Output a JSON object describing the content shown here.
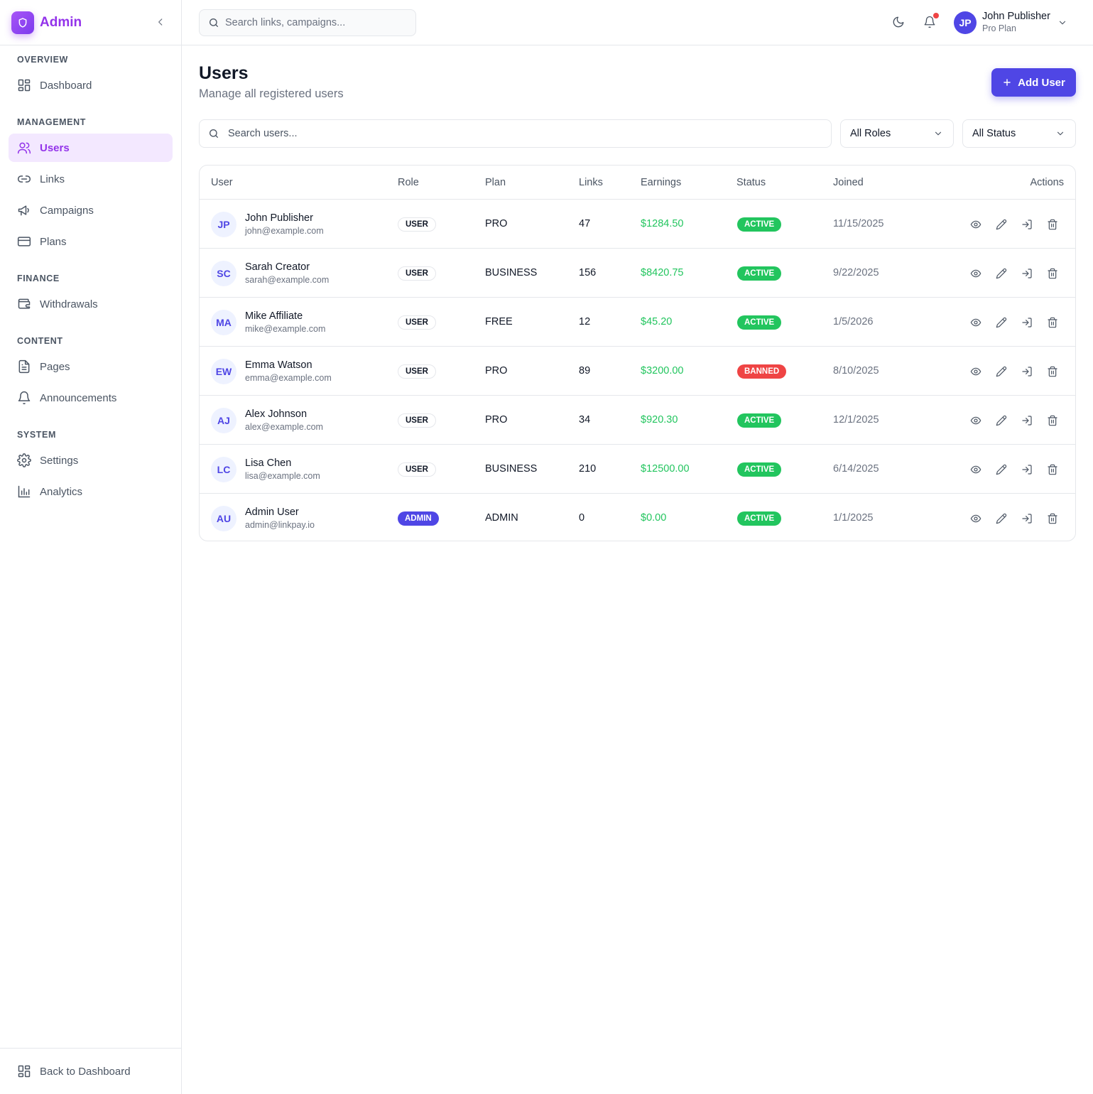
{
  "sidebar": {
    "brand": "Admin",
    "sections": [
      {
        "label": "OVERVIEW",
        "items": [
          {
            "label": "Dashboard",
            "icon": "dashboard-icon"
          }
        ]
      },
      {
        "label": "MANAGEMENT",
        "items": [
          {
            "label": "Users",
            "icon": "users-icon",
            "active": true
          },
          {
            "label": "Links",
            "icon": "link-icon"
          },
          {
            "label": "Campaigns",
            "icon": "megaphone-icon"
          },
          {
            "label": "Plans",
            "icon": "credit-card-icon"
          }
        ]
      },
      {
        "label": "FINANCE",
        "items": [
          {
            "label": "Withdrawals",
            "icon": "wallet-icon"
          }
        ]
      },
      {
        "label": "CONTENT",
        "items": [
          {
            "label": "Pages",
            "icon": "file-text-icon"
          },
          {
            "label": "Announcements",
            "icon": "bell-icon"
          }
        ]
      },
      {
        "label": "SYSTEM",
        "items": [
          {
            "label": "Settings",
            "icon": "gear-icon"
          },
          {
            "label": "Analytics",
            "icon": "bar-chart-icon"
          }
        ]
      }
    ],
    "footer": {
      "label": "Back to Dashboard",
      "icon": "dashboard-icon"
    }
  },
  "topbar": {
    "search_placeholder": "Search links, campaigns...",
    "user": {
      "initials": "JP",
      "name": "John Publisher",
      "plan": "Pro Plan"
    }
  },
  "page": {
    "title": "Users",
    "subtitle": "Manage all registered users",
    "add_button": "Add User",
    "search_placeholder": "Search users...",
    "role_filter": "All Roles",
    "status_filter": "All Status"
  },
  "table": {
    "headers": [
      "User",
      "Role",
      "Plan",
      "Links",
      "Earnings",
      "Status",
      "Joined",
      "Actions"
    ],
    "rows": [
      {
        "initials": "JP",
        "name": "John Publisher",
        "email": "john@example.com",
        "role": "USER",
        "plan": "PRO",
        "links": "47",
        "earnings": "$1284.50",
        "status": "ACTIVE",
        "joined": "11/15/2025"
      },
      {
        "initials": "SC",
        "name": "Sarah Creator",
        "email": "sarah@example.com",
        "role": "USER",
        "plan": "BUSINESS",
        "links": "156",
        "earnings": "$8420.75",
        "status": "ACTIVE",
        "joined": "9/22/2025"
      },
      {
        "initials": "MA",
        "name": "Mike Affiliate",
        "email": "mike@example.com",
        "role": "USER",
        "plan": "FREE",
        "links": "12",
        "earnings": "$45.20",
        "status": "ACTIVE",
        "joined": "1/5/2026"
      },
      {
        "initials": "EW",
        "name": "Emma Watson",
        "email": "emma@example.com",
        "role": "USER",
        "plan": "PRO",
        "links": "89",
        "earnings": "$3200.00",
        "status": "BANNED",
        "joined": "8/10/2025"
      },
      {
        "initials": "AJ",
        "name": "Alex Johnson",
        "email": "alex@example.com",
        "role": "USER",
        "plan": "PRO",
        "links": "34",
        "earnings": "$920.30",
        "status": "ACTIVE",
        "joined": "12/1/2025"
      },
      {
        "initials": "LC",
        "name": "Lisa Chen",
        "email": "lisa@example.com",
        "role": "USER",
        "plan": "BUSINESS",
        "links": "210",
        "earnings": "$12500.00",
        "status": "ACTIVE",
        "joined": "6/14/2025"
      },
      {
        "initials": "AU",
        "name": "Admin User",
        "email": "admin@linkpay.io",
        "role": "ADMIN",
        "plan": "ADMIN",
        "links": "0",
        "earnings": "$0.00",
        "status": "ACTIVE",
        "joined": "1/1/2025"
      }
    ]
  },
  "colors": {
    "accent": "#4f46e5",
    "brand": "#9333ea",
    "success": "#22c55e",
    "danger": "#ef4444"
  }
}
